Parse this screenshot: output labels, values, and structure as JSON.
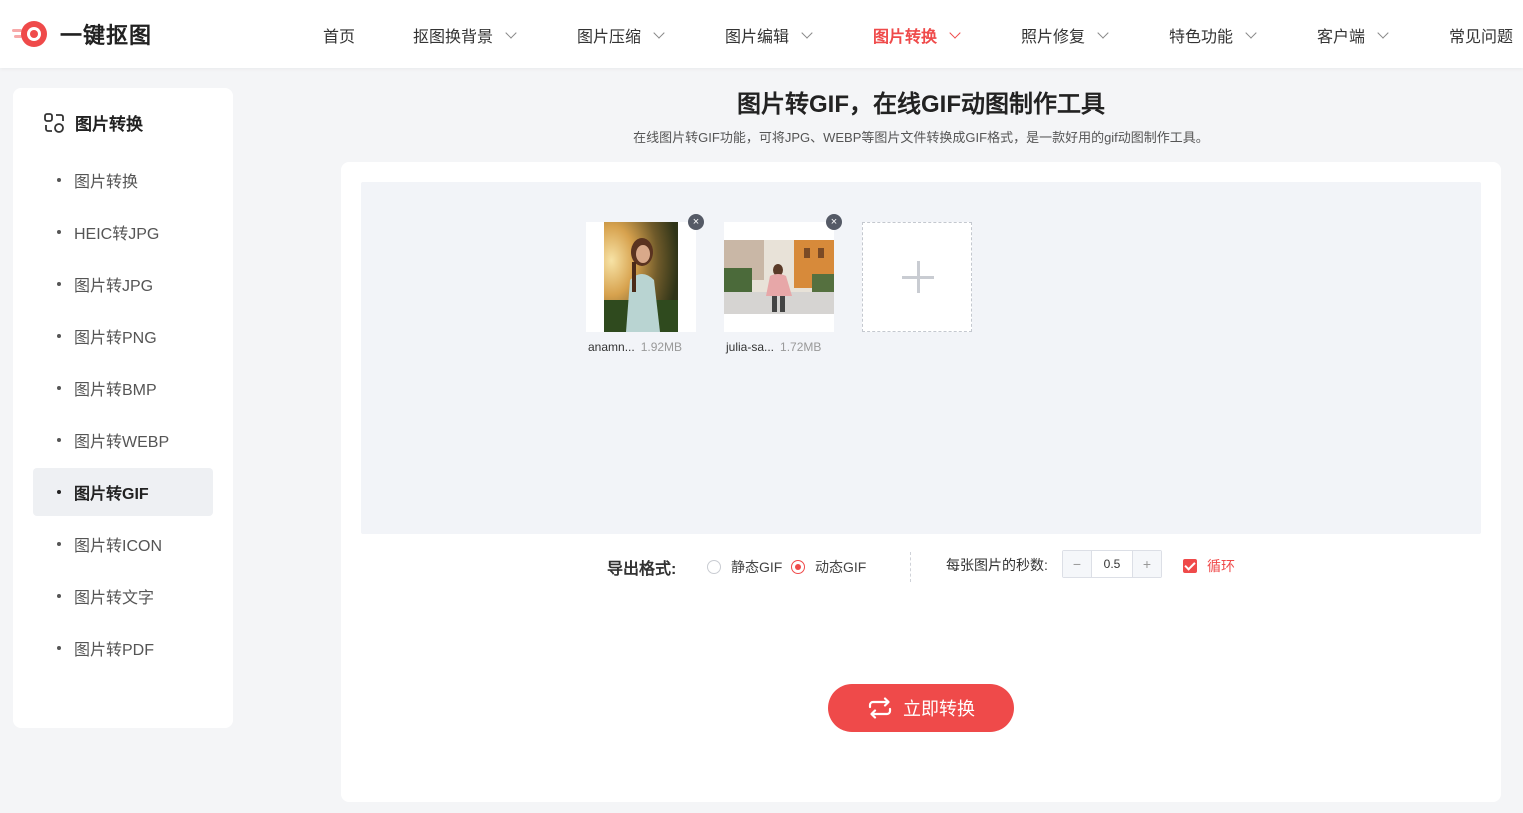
{
  "brand": {
    "name": "一键抠图",
    "accent": "#ef4a4a"
  },
  "nav": [
    {
      "label": "首页",
      "dropdown": false,
      "active": false
    },
    {
      "label": "抠图换背景",
      "dropdown": true,
      "active": false
    },
    {
      "label": "图片压缩",
      "dropdown": true,
      "active": false
    },
    {
      "label": "图片编辑",
      "dropdown": true,
      "active": false
    },
    {
      "label": "图片转换",
      "dropdown": true,
      "active": true
    },
    {
      "label": "照片修复",
      "dropdown": true,
      "active": false
    },
    {
      "label": "特色功能",
      "dropdown": true,
      "active": false
    },
    {
      "label": "客户端",
      "dropdown": true,
      "active": false
    },
    {
      "label": "常见问题",
      "dropdown": false,
      "active": false
    }
  ],
  "sidebar": {
    "title": "图片转换",
    "items": [
      {
        "label": "图片转换",
        "active": false
      },
      {
        "label": "HEIC转JPG",
        "active": false
      },
      {
        "label": "图片转JPG",
        "active": false
      },
      {
        "label": "图片转PNG",
        "active": false
      },
      {
        "label": "图片转BMP",
        "active": false
      },
      {
        "label": "图片转WEBP",
        "active": false
      },
      {
        "label": "图片转GIF",
        "active": true
      },
      {
        "label": "图片转ICON",
        "active": false
      },
      {
        "label": "图片转文字",
        "active": false
      },
      {
        "label": "图片转PDF",
        "active": false
      }
    ]
  },
  "main": {
    "title": "图片转GIF，在线GIF动图制作工具",
    "subtitle": "在线图片转GIF功能，可将JPG、WEBP等图片文件转换成GIF格式，是一款好用的gif动图制作工具。"
  },
  "files": [
    {
      "name": "anamn...",
      "size": "1.92MB"
    },
    {
      "name": "julia-sa...",
      "size": "1.72MB"
    }
  ],
  "options": {
    "format_label": "导出格式:",
    "static_label": "静态GIF",
    "animated_label": "动态GIF",
    "selected_format": "动态GIF",
    "seconds_label": "每张图片的秒数:",
    "seconds_value": "0.5",
    "minus": "−",
    "plus": "+",
    "loop_label": "循环",
    "loop_checked": true
  },
  "convert_button": {
    "label": "立即转换"
  }
}
